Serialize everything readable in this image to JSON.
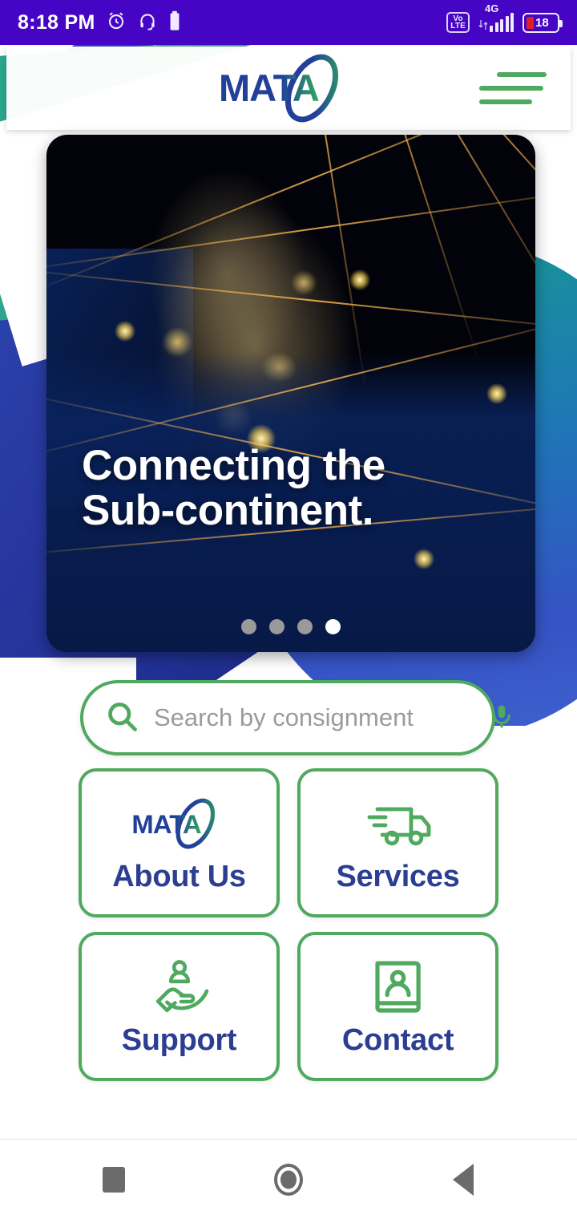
{
  "status_bar": {
    "time": "8:18 PM",
    "alarm_icon": "alarm-clock-icon",
    "headphone_icon": "headphones-icon",
    "battery_left_icon": "battery-icon",
    "volte_label_line1": "Vo",
    "volte_label_line2": "LTE",
    "network_type": "4G",
    "battery_percent": "18",
    "background_color": "#4604c4"
  },
  "header": {
    "logo_text": "MATA",
    "logo_colors": {
      "blue": "#22409a",
      "green": "#2fa95c"
    },
    "menu_icon": "hamburger-menu-icon",
    "menu_color": "#4fa95e"
  },
  "hero": {
    "headline_line1": "Connecting the",
    "headline_line2": "Sub-continent.",
    "image_description": "night-satellite-map-of-indian-subcontinent-with-flight-routes",
    "dots": [
      {
        "active": false
      },
      {
        "active": false
      },
      {
        "active": false
      },
      {
        "active": true
      }
    ],
    "active_dot_index": 3,
    "total_slides": 4
  },
  "search": {
    "placeholder": "Search by consignment",
    "value": "",
    "search_icon": "search-icon",
    "mic_icon": "microphone-icon",
    "border_color": "#4fa95e"
  },
  "tiles": [
    {
      "label": "About Us",
      "icon": "mata-logo-icon"
    },
    {
      "label": "Services",
      "icon": "delivery-truck-icon"
    },
    {
      "label": "Support",
      "icon": "hand-holding-person-icon"
    },
    {
      "label": "Contact",
      "icon": "contact-card-icon"
    }
  ],
  "theme": {
    "green": "#4fa95e",
    "navy": "#2c3e91",
    "status_purple": "#4604c4"
  },
  "nav_bar": {
    "recents_label": "Recents",
    "home_label": "Home",
    "back_label": "Back",
    "recents_icon": "square-icon",
    "home_icon": "circle-icon",
    "back_icon": "triangle-back-icon"
  }
}
